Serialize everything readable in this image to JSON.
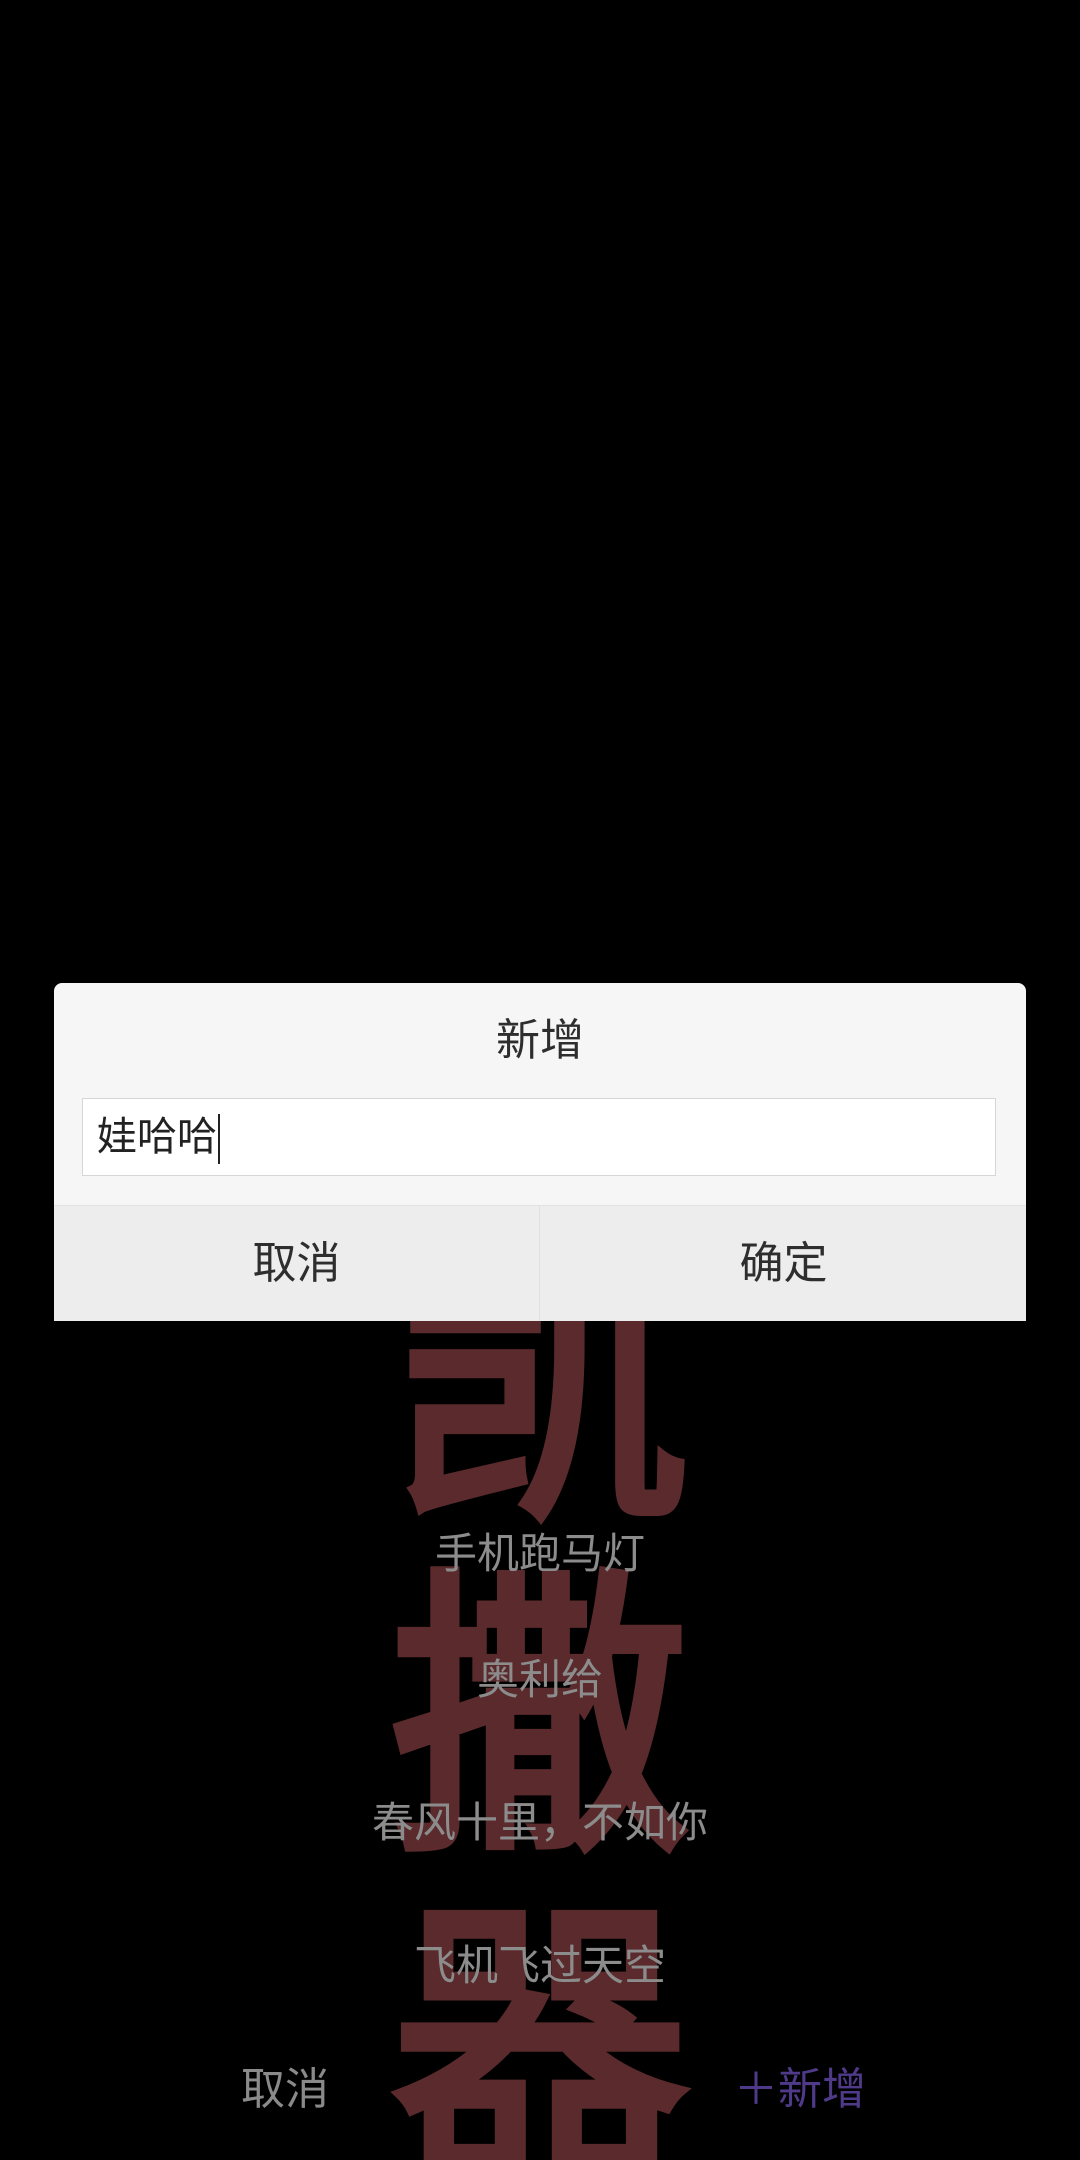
{
  "marquee": {
    "text": "凯撒器"
  },
  "presets": [
    "手机跑马灯",
    "奥利给",
    "春风十里，不如你",
    "飞机飞过天空"
  ],
  "bottom_bar": {
    "cancel_label": "取消",
    "add_label": "＋新增"
  },
  "dialog": {
    "title": "新增",
    "input_value": "娃哈哈",
    "cancel_label": "取消",
    "confirm_label": "确定"
  },
  "colors": {
    "background": "#000000",
    "marquee_glyph": "#5a2a2c",
    "add_accent": "#4f3a8a",
    "dialog_bg": "#f5f6f5"
  }
}
